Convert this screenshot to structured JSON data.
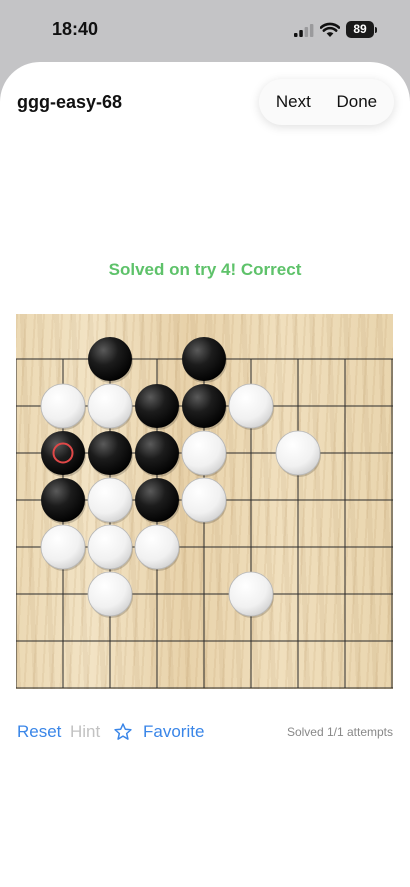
{
  "status_bar": {
    "time": "18:40",
    "battery": "89"
  },
  "sheet": {
    "title": "ggg-easy-68",
    "next_label": "Next",
    "done_label": "Done"
  },
  "result": {
    "text": "Solved on try 4! Correct",
    "color": "#5ec26a"
  },
  "board": {
    "grid_cols": 7,
    "grid_rows": 7,
    "stones": [
      {
        "color": "black",
        "col": 1,
        "row": 0
      },
      {
        "color": "black",
        "col": 3,
        "row": 0
      },
      {
        "color": "white",
        "col": 0,
        "row": 1
      },
      {
        "color": "white",
        "col": 1,
        "row": 1
      },
      {
        "color": "black",
        "col": 2,
        "row": 1
      },
      {
        "color": "black",
        "col": 3,
        "row": 1
      },
      {
        "color": "white",
        "col": 4,
        "row": 1
      },
      {
        "color": "black",
        "col": 0,
        "row": 2,
        "last_move": true
      },
      {
        "color": "black",
        "col": 1,
        "row": 2
      },
      {
        "color": "black",
        "col": 2,
        "row": 2
      },
      {
        "color": "white",
        "col": 3,
        "row": 2
      },
      {
        "color": "white",
        "col": 5,
        "row": 2
      },
      {
        "color": "black",
        "col": 0,
        "row": 3
      },
      {
        "color": "white",
        "col": 1,
        "row": 3
      },
      {
        "color": "black",
        "col": 2,
        "row": 3
      },
      {
        "color": "white",
        "col": 3,
        "row": 3
      },
      {
        "color": "white",
        "col": 0,
        "row": 4
      },
      {
        "color": "white",
        "col": 1,
        "row": 4
      },
      {
        "color": "white",
        "col": 2,
        "row": 4
      },
      {
        "color": "white",
        "col": 1,
        "row": 5
      },
      {
        "color": "white",
        "col": 4,
        "row": 5
      }
    ],
    "last_move_marker_color": "#e04848"
  },
  "toolbar": {
    "reset_label": "Reset",
    "hint_label": "Hint",
    "favorite_label": "Favorite",
    "attempts": "Solved 1/1 attempts",
    "accent_color": "#3a86e8",
    "disabled_color": "#c2c2c2"
  }
}
